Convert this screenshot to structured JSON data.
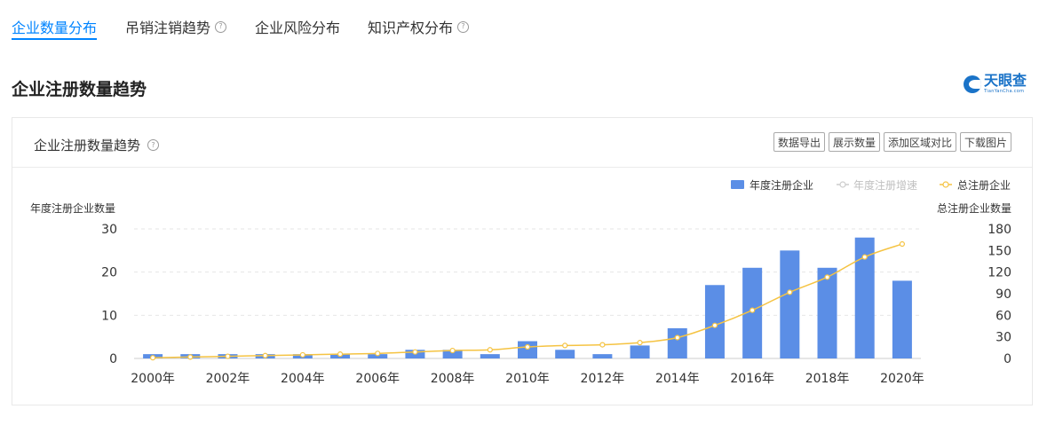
{
  "tabs": [
    {
      "label": "企业数量分布",
      "active": true,
      "help": false
    },
    {
      "label": "吊销注销趋势",
      "active": false,
      "help": true
    },
    {
      "label": "企业风险分布",
      "active": false,
      "help": false
    },
    {
      "label": "知识产权分布",
      "active": false,
      "help": true
    }
  ],
  "section_title": "企业注册数量趋势",
  "logo": {
    "cn": "天眼查",
    "en": "TianYanCha.com"
  },
  "card": {
    "title": "企业注册数量趋势",
    "buttons": [
      "数据导出",
      "展示数量",
      "添加区域对比",
      "下载图片"
    ]
  },
  "colors": {
    "bar": "#5b8ee6",
    "total_line": "#f5c342",
    "growth_line": "#cccccc",
    "accent": "#0084ff"
  },
  "chart_data": {
    "type": "bar",
    "x": [
      "2000年",
      "2001年",
      "2002年",
      "2003年",
      "2004年",
      "2005年",
      "2006年",
      "2007年",
      "2008年",
      "2009年",
      "2010年",
      "2011年",
      "2012年",
      "2013年",
      "2014年",
      "2015年",
      "2016年",
      "2017年",
      "2018年",
      "2019年",
      "2020年"
    ],
    "x_tick_labels": [
      "2000年",
      "2002年",
      "2004年",
      "2006年",
      "2008年",
      "2010年",
      "2012年",
      "2014年",
      "2016年",
      "2018年",
      "2020年"
    ],
    "ylabel_left": "年度注册企业数量",
    "ylabel_right": "总注册企业数量",
    "ylim_left": [
      0,
      30
    ],
    "yticks_left": [
      0,
      10,
      20,
      30
    ],
    "ylim_right": [
      0,
      180
    ],
    "yticks_right": [
      0,
      30,
      60,
      90,
      120,
      150,
      180
    ],
    "grid": true,
    "legend_position": "top-right",
    "series": [
      {
        "name": "年度注册企业",
        "type": "bar",
        "axis": "left",
        "values": [
          1,
          1,
          1,
          1,
          1,
          1,
          1,
          2,
          2,
          1,
          4,
          2,
          1,
          3,
          7,
          17,
          21,
          25,
          21,
          28,
          18
        ]
      },
      {
        "name": "年度注册增速",
        "type": "line",
        "axis": "left",
        "values": []
      },
      {
        "name": "总注册企业",
        "type": "line",
        "axis": "right",
        "values": [
          1,
          2,
          3,
          4,
          5,
          6,
          7,
          9,
          11,
          12,
          16,
          18,
          19,
          22,
          29,
          46,
          67,
          92,
          113,
          141,
          159
        ]
      }
    ]
  }
}
